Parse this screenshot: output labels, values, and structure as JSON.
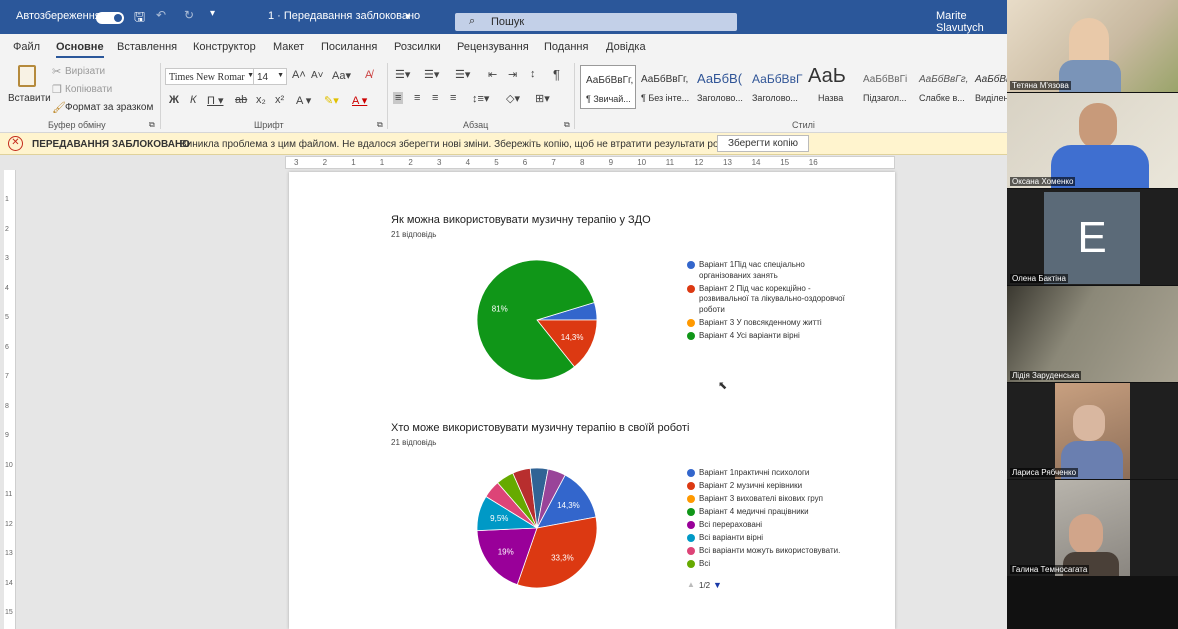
{
  "titlebar": {
    "autosave": "Автозбереження",
    "doc_title": "1 · Передавання заблоковано",
    "search_placeholder": "Пошук",
    "user": "Marite Slavutych"
  },
  "tabs": [
    "Файл",
    "Основне",
    "Вставлення",
    "Конструктор",
    "Макет",
    "Посилання",
    "Розсилки",
    "Рецензування",
    "Подання",
    "Довідка"
  ],
  "ribbon": {
    "clipboard": {
      "paste": "Вставити",
      "cut": "Вирізати",
      "copy": "Копіювати",
      "format_painter": "Формат за зразком",
      "label": "Буфер обміну"
    },
    "font": {
      "name": "Times New Romar",
      "size": "14",
      "label": "Шрифт"
    },
    "paragraph": {
      "label": "Абзац"
    },
    "styles": {
      "label": "Стилі",
      "items": [
        {
          "preview": "АаБбВвГг,",
          "name": "¶ Звичай..."
        },
        {
          "preview": "АаБбВвГг,",
          "name": "¶ Без інте..."
        },
        {
          "preview": "АаБбВ(",
          "name": "Заголово..."
        },
        {
          "preview": "АаБбВвГ",
          "name": "Заголово..."
        },
        {
          "preview": "АаЬ",
          "name": "Назва"
        },
        {
          "preview": "АаБбВвГі",
          "name": "Підзагол..."
        },
        {
          "preview": "АаБбВвГг,",
          "name": "Слабке в..."
        },
        {
          "preview": "АаБбВв",
          "name": "Виділен..."
        }
      ]
    }
  },
  "message": {
    "title": "ПЕРЕДАВАННЯ ЗАБЛОКОВАНО",
    "text": "Виникла проблема з цим файлом. Не вдалося зберегти нові зміни. Збережіть копію, щоб не втратити результати роботи.",
    "button": "Зберегти копію"
  },
  "ruler_numbers": [
    "3",
    "2",
    "1",
    "1",
    "2",
    "3",
    "4",
    "5",
    "6",
    "7",
    "8",
    "9",
    "10",
    "11",
    "12",
    "13",
    "14",
    "15",
    "16"
  ],
  "vruler_numbers": [
    "1",
    "2",
    "3",
    "4",
    "5",
    "6",
    "7",
    "8",
    "9",
    "10",
    "11",
    "12",
    "13",
    "14",
    "15"
  ],
  "chart_data": [
    {
      "type": "pie",
      "title": "Як можна використовувати музичну терапію у ЗДО",
      "subtitle": "21 відповідь",
      "labels": [
        "Варіант 1Під час спеціально організованих занять",
        "Варіант 2 Під час корекційно - розвивальної та лікувально-оздоровчої роботи",
        "Варіант 3 У повсякденному житті",
        "Варіант 4 Усі варіанти вірні"
      ],
      "values": [
        4.7,
        14.3,
        0,
        81
      ],
      "value_labels": [
        "",
        "14,3%",
        "",
        "81%"
      ],
      "colors": [
        "#3366cc",
        "#dc3912",
        "#ff9900",
        "#109618"
      ]
    },
    {
      "type": "pie",
      "title": "Хто може використовувати музичну терапію в своїй роботі",
      "subtitle": "21 відповідь",
      "labels": [
        "Варіант 1практичні психологи",
        "Варіант 2 музичні керівники",
        "Варіант 3 вихователі вікових груп",
        "Варіант 4 медичні працівники",
        "Всі перераховані",
        "Всі варіанти вірні",
        "Всі варіанти можуть використовувати.",
        "Всі"
      ],
      "values": [
        14.3,
        33.3,
        0,
        0,
        19,
        9.5,
        4.8,
        4.8,
        4.8,
        4.8,
        4.8
      ],
      "value_labels": [
        "14,3%",
        "33,3%",
        "",
        "",
        "19%",
        "9,5%",
        "",
        "",
        "",
        "",
        ""
      ],
      "colors": [
        "#3366cc",
        "#dc3912",
        "#ff9900",
        "#109618",
        "#990099",
        "#0099c6",
        "#dd4477",
        "#66aa00",
        "#b82e2e",
        "#316395",
        "#994499"
      ],
      "legend_page": "1/2"
    }
  ],
  "participants": [
    {
      "name": "Тетяна М'язова"
    },
    {
      "name": "Оксана Хоменко"
    },
    {
      "name": "Олена Бактіна",
      "initial": "E"
    },
    {
      "name": "Лідія Заруденська"
    },
    {
      "name": "Лариса Рябченко"
    },
    {
      "name": "Галина Темносагата"
    }
  ]
}
